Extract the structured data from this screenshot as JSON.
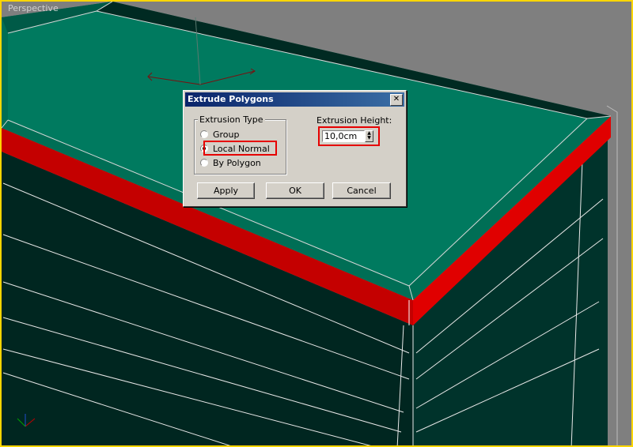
{
  "viewport": {
    "label": "Perspective"
  },
  "dialog": {
    "title": "Extrude Polygons",
    "close_glyph": "✕",
    "extrusion_type": {
      "legend": "Extrusion Type",
      "options": [
        {
          "label": "Group",
          "selected": false
        },
        {
          "label": "Local Normal",
          "selected": true
        },
        {
          "label": "By Polygon",
          "selected": false
        }
      ]
    },
    "extrusion_height": {
      "label": "Extrusion Height:",
      "value": "10,0cm"
    },
    "buttons": {
      "apply": "Apply",
      "ok": "OK",
      "cancel": "Cancel"
    }
  },
  "colors": {
    "highlight": "#e60000",
    "top_face": "#006e55",
    "side_face": "#002620",
    "red_band": "#c40000",
    "viewport_border": "#ffd600"
  }
}
